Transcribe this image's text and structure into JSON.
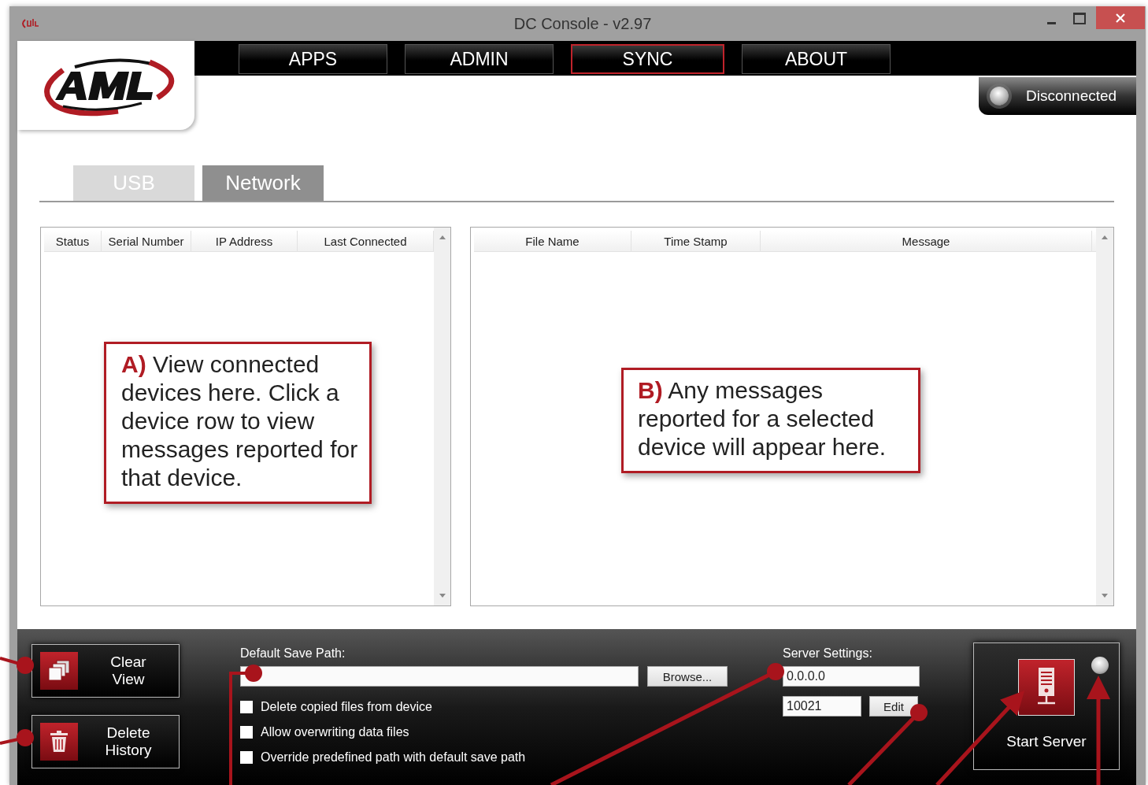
{
  "window": {
    "title": "DC Console - v2.97"
  },
  "nav_tabs": [
    {
      "label": "APPS",
      "selected": false
    },
    {
      "label": "ADMIN",
      "selected": false
    },
    {
      "label": "SYNC",
      "selected": true
    },
    {
      "label": "ABOUT",
      "selected": false
    }
  ],
  "connection_status": "Disconnected",
  "device_tabs": [
    {
      "label": "USB",
      "selected": false
    },
    {
      "label": "Network",
      "selected": true
    }
  ],
  "devices_table": {
    "columns": [
      "Status",
      "Serial Number",
      "IP Address",
      "Last Connected"
    ]
  },
  "messages_table": {
    "columns": [
      "File Name",
      "Time Stamp",
      "Message"
    ]
  },
  "callouts": [
    {
      "text": "**A)** View connected devices here. Click a device row to view messages reported for that device."
    },
    {
      "text": "**B)** Any messages reported for a selected device will appear here."
    }
  ],
  "side_buttons": [
    {
      "label": "Clear View",
      "kind": "clear"
    },
    {
      "label": "Delete History",
      "kind": "delete"
    }
  ],
  "save_path": {
    "label": "Default Save Path:",
    "browse_button": "Browse..."
  },
  "options": [
    {
      "label": "Delete copied files from device",
      "checked": false
    },
    {
      "label": "Allow overwriting data files",
      "checked": false
    },
    {
      "label": "Override predefined path with default save path",
      "checked": false
    }
  ],
  "server_settings": {
    "label": "Server Settings:",
    "address": "0.0.0.0",
    "port": "10021",
    "edit_button": "Edit"
  },
  "start_server": {
    "label": "Start Server"
  }
}
